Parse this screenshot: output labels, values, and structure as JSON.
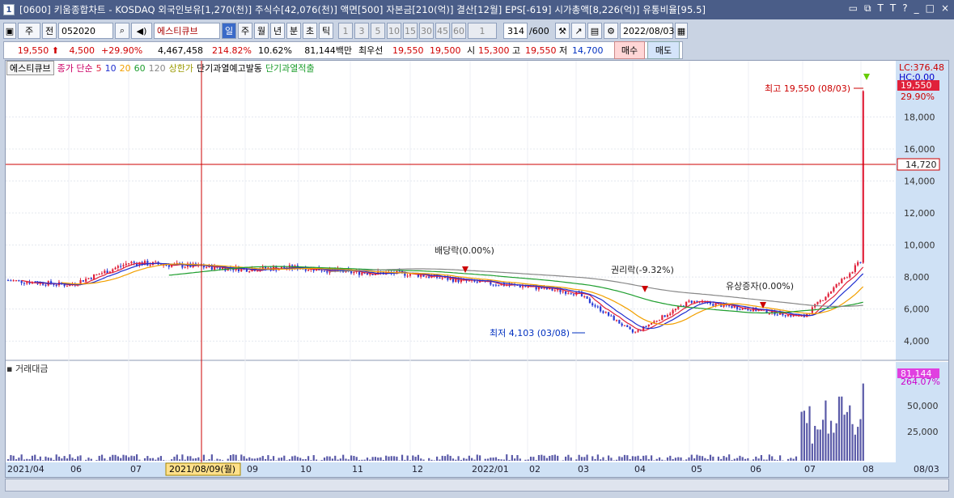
{
  "title_number": "1",
  "title": "[0600] 키움종합차트 - KOSDAQ 외국인보유[1,270(천)] 주식수[42,076(천)] 액면[500] 자본금[210(억)] 결산[12월] EPS[-619] 시가총액[8,226(억)] 유통비율[95.5]",
  "window_buttons": [
    "▭",
    "⧉",
    "T",
    "T",
    "?",
    "_",
    "□",
    "×"
  ],
  "toolbar": {
    "period_type": "주",
    "mode": "전",
    "code": "052020",
    "stock_name": "에스티큐브",
    "periods": [
      "일",
      "주",
      "월",
      "년",
      "분",
      "초",
      "틱"
    ],
    "active_period": "일",
    "intervals": [
      "1",
      "3",
      "5",
      "10",
      "15",
      "30",
      "45",
      "60"
    ],
    "interval_value": "1",
    "count": "314",
    "count_max": "/600",
    "date": "2022/08/03"
  },
  "price_bar": {
    "price": "19,550",
    "change": "4,500",
    "change_pct": "+29.90%",
    "volume": "4,467,458",
    "volume_ratio": "214.82%",
    "turnover": "10.62%",
    "amount": "81,144백만",
    "best_bid_label": "최우선",
    "best_ask": "19,550",
    "best_bid": "19,500",
    "open_label": "시",
    "open": "15,300",
    "high_label": "고",
    "high": "19,550",
    "low_label": "저",
    "low": "14,700",
    "buy": "매수",
    "sell": "매도"
  },
  "legend": {
    "name": "에스티큐브",
    "ma_label": "종가 단순",
    "ma": [
      "5",
      "10",
      "20",
      "60",
      "120"
    ],
    "limit_up": "상한가",
    "warn1": "단기과열예고발동",
    "warn2": "단기과열적출"
  },
  "annotations": {
    "high": "최고 19,550 (08/03)",
    "low": "최저 4,103 (03/08)",
    "dividend": "배당락(0.00%)",
    "rights": "권리락(-9.32%)",
    "capital": "유상증자(0.00%)"
  },
  "axis": {
    "lc": "LC:376.48",
    "hc": "HC:0.00",
    "price_tag": "19,550",
    "pct_tag": "29.90%",
    "cross_tag": "14,720",
    "price_ticks": [
      "18,000",
      "16,000",
      "14,000",
      "12,000",
      "10,000",
      "8,000",
      "6,000",
      "4,000"
    ],
    "vol_tag": "81,144",
    "vol_pct": "264.07%",
    "vol_ticks": [
      "50,000",
      "25,000"
    ],
    "dates": [
      "2021/04",
      "06",
      "07",
      "09",
      "10",
      "11",
      "12",
      "2022/01",
      "02",
      "03",
      "04",
      "05",
      "06",
      "07",
      "08",
      "08/03"
    ],
    "cursor_date": "2021/08/09(월)"
  },
  "volume_label": "거래대금",
  "chart_data": {
    "type": "candlestick",
    "price_range": [
      3000,
      20500
    ],
    "monthly_close": [
      {
        "m": "2021/04",
        "v": 7800
      },
      {
        "m": "2021/06",
        "v": 7500
      },
      {
        "m": "2021/07",
        "v": 8900
      },
      {
        "m": "2021/08",
        "v": 8500
      },
      {
        "m": "2021/09",
        "v": 8600
      },
      {
        "m": "2021/10",
        "v": 8300
      },
      {
        "m": "2021/11",
        "v": 8200
      },
      {
        "m": "2021/12",
        "v": 7700
      },
      {
        "m": "2022/01",
        "v": 7400
      },
      {
        "m": "2022/02",
        "v": 7000
      },
      {
        "m": "2022/03",
        "v": 4500
      },
      {
        "m": "2022/04",
        "v": 6500
      },
      {
        "m": "2022/05",
        "v": 6000
      },
      {
        "m": "2022/06",
        "v": 5500
      },
      {
        "m": "2022/07",
        "v": 9000
      },
      {
        "m": "2022/08",
        "v": 19550
      }
    ],
    "high_point": {
      "date": "08/03",
      "value": 19550
    },
    "low_point": {
      "date": "03/08",
      "value": 4103
    },
    "volume_range": [
      0,
      85000
    ]
  },
  "colors": {
    "up": "#e0213a",
    "down": "#2a3bd6",
    "ma5": "#e0213a",
    "ma10": "#1f2fd0",
    "ma20": "#f2a000",
    "ma60": "#1e9e2e",
    "ma120": "#888888",
    "axis_bg": "#cfe1f5"
  }
}
